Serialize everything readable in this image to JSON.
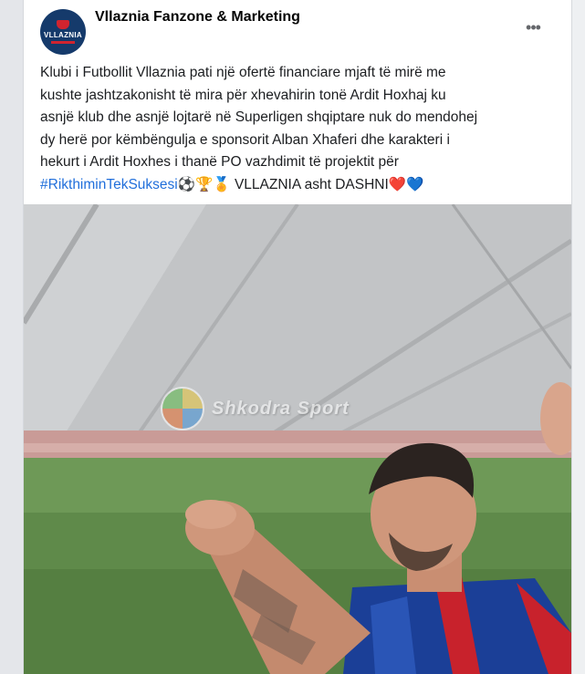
{
  "post": {
    "page_name": "Vllaznia Fanzone & Marketing",
    "avatar_text": "VLLAZNIA",
    "more_options_label": "•••",
    "text_lines": [
      "Klubi i Futbollit Vllaznia pati një ofertë financiare mjaft të mirë me",
      "kushte jashtzakonisht të mira për xhevahirin tonë Ardit Hoxhaj ku",
      "asnjë klub dhe asnjë lojtarë në Superligen shqiptare nuk do mendohej",
      "dy herë por këmbëngulja e sponsorit Alban Xhaferi dhe karakteri i",
      "hekurt i Ardit Hoxhes i thanë PO vazhdimit të projektit për"
    ],
    "hashtag": "#RikthiminTekSuksesi",
    "emojis": "⚽🏆🏅",
    "closing_text": " VLLAZNIA asht DASHNI",
    "hearts": "❤️💙"
  },
  "photo": {
    "watermark_text": "Shkodra Sport"
  },
  "colors": {
    "hashtag": "#216fdb",
    "avatar_bg": "#153a6b",
    "club_red": "#d1242f"
  }
}
